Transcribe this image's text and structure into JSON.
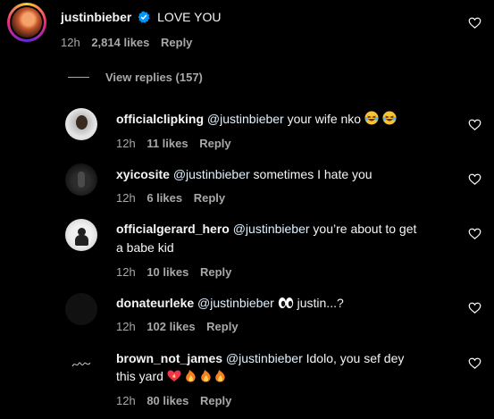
{
  "main_comment": {
    "username": "justinbieber",
    "text": "LOVE YOU",
    "time": "12h",
    "likes": "2,814 likes",
    "reply": "Reply",
    "view_replies": "View replies (157)"
  },
  "replies": [
    {
      "username": "officialclipking",
      "mention": "@justinbieber",
      "text": "your wife nko",
      "time": "12h",
      "likes": "11 likes",
      "reply": "Reply"
    },
    {
      "username": "xyicosite",
      "mention": "@justinbieber",
      "text": "sometimes I hate you",
      "time": "12h",
      "likes": "6 likes",
      "reply": "Reply"
    },
    {
      "username": "officialgerard_hero",
      "mention": "@justinbieber",
      "text": "you’re about to get",
      "text2": "a babe kid",
      "time": "12h",
      "likes": "10 likes",
      "reply": "Reply"
    },
    {
      "username": "donateurleke",
      "mention": "@justinbieber",
      "text": "justin...?",
      "time": "12h",
      "likes": "102 likes",
      "reply": "Reply"
    },
    {
      "username": "brown_not_james",
      "mention": "@justinbieber",
      "text": "Idolo, you sef dey",
      "text2": "this yard",
      "time": "12h",
      "likes": "80 likes",
      "reply": "Reply"
    }
  ],
  "icons": {
    "verified": "verified-badge-icon",
    "heart": "heart-outline-icon",
    "emoji_laugh": "laughing-face-emoji",
    "emoji_eyes": "eyes-emoji",
    "emoji_heart": "heart-on-fire-emoji",
    "emoji_fire": "fire-emoji"
  },
  "colors": {
    "background": "#000000",
    "text": "#f5f5f5",
    "muted": "#a8a8a8",
    "verified": "#0095f6"
  }
}
